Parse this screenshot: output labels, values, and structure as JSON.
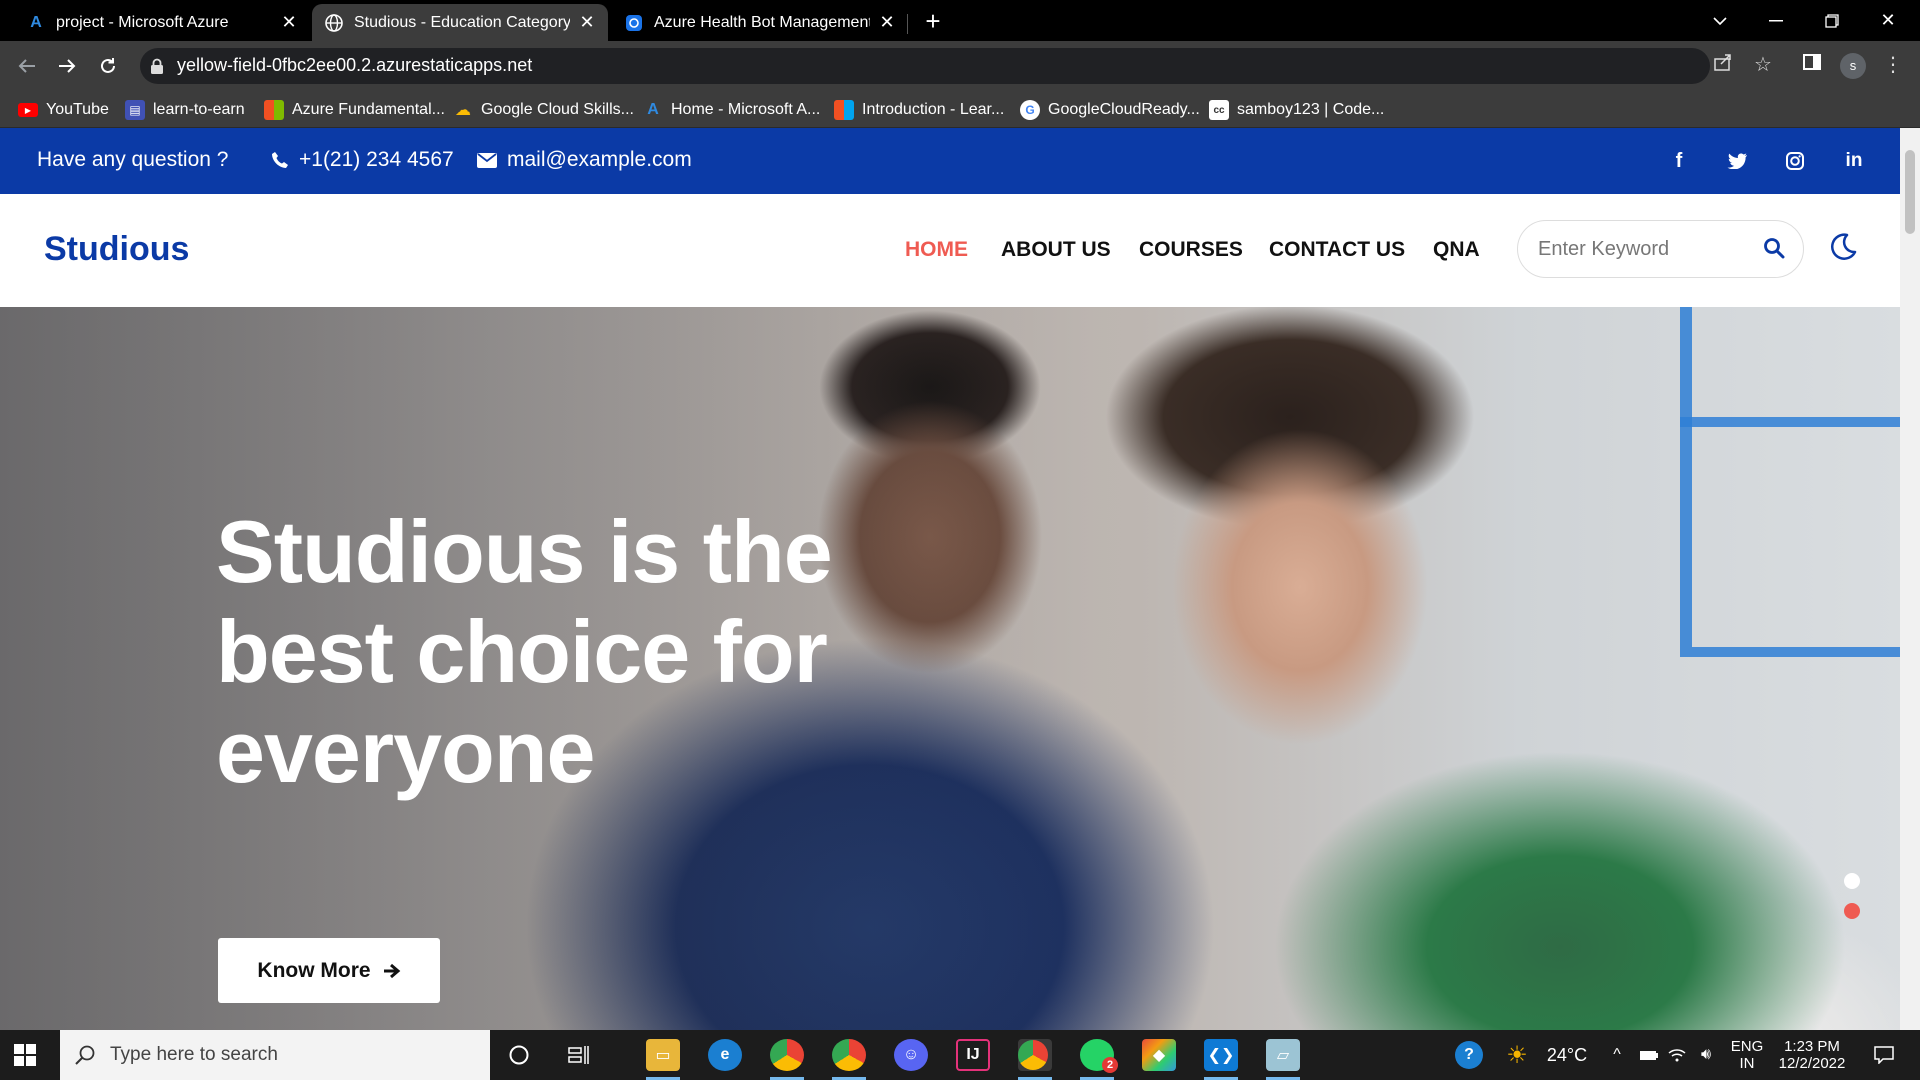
{
  "browser": {
    "tabs": [
      {
        "title": "project - Microsoft Azure",
        "active": false
      },
      {
        "title": "Studious - Education Category Re",
        "active": true
      },
      {
        "title": "Azure Health Bot Management P",
        "active": false
      }
    ],
    "url": "yellow-field-0fbc2ee00.2.azurestaticapps.net",
    "profile_initial": "s",
    "bookmarks": [
      "YouTube",
      "learn-to-earn",
      "Azure Fundamental...",
      "Google Cloud Skills...",
      "Home - Microsoft A...",
      "Introduction - Lear...",
      "GoogleCloudReady...",
      "samboy123 | Code..."
    ]
  },
  "site": {
    "topbar": {
      "question": "Have any question ?",
      "phone": "+1(21) 234 4567",
      "email": "mail@example.com",
      "background": "#0b3aa6"
    },
    "brand": "Studious",
    "nav": [
      "HOME",
      "ABOUT US",
      "COURSES",
      "CONTACT US",
      "QNA"
    ],
    "active_nav": "HOME",
    "accent": "#ef5b52",
    "search_placeholder": "Enter Keyword",
    "hero": {
      "title_lines": [
        "Studious is the",
        "best choice for",
        "everyone"
      ],
      "button": "Know More",
      "slider_dots": 2,
      "active_dot": 2
    }
  },
  "taskbar": {
    "search_placeholder": "Type here to search",
    "weather": "24°C",
    "lang_top": "ENG",
    "lang_bottom": "IN",
    "time": "1:23 PM",
    "date": "12/2/2022",
    "whatsapp_badge": "2"
  }
}
